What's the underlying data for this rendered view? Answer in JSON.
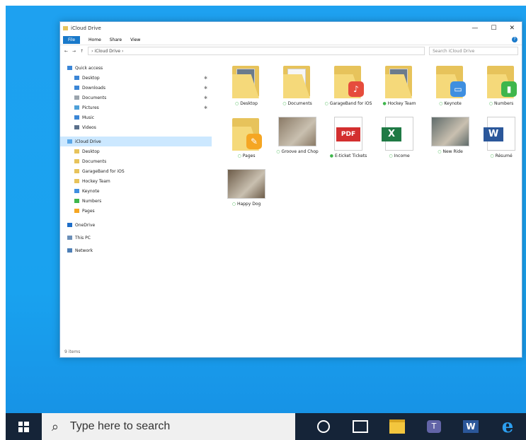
{
  "window": {
    "title": "iCloud Drive",
    "controls": {
      "minimize": "—",
      "maximize": "☐",
      "close": "✕"
    },
    "ribbon": {
      "file": "File",
      "home": "Home",
      "share": "Share",
      "view": "View",
      "help": "?"
    },
    "address": {
      "path": "› iCloud Drive ›",
      "search_placeholder": "Search iCloud Drive"
    },
    "status": "9 items"
  },
  "nav": {
    "quick_access": "Quick access",
    "quick_items": [
      {
        "label": "Desktop",
        "color": "#3b86d6",
        "pin": "✱"
      },
      {
        "label": "Downloads",
        "color": "#3b86d6",
        "pin": "✱"
      },
      {
        "label": "Documents",
        "color": "#9aa4ad",
        "pin": "✱"
      },
      {
        "label": "Pictures",
        "color": "#4ea0d8",
        "pin": "✱"
      },
      {
        "label": "Music",
        "color": "#3b86d6",
        "pin": ""
      },
      {
        "label": "Videos",
        "color": "#5a6f8a",
        "pin": ""
      }
    ],
    "icloud": "iCloud Drive",
    "icloud_items": [
      {
        "label": "Desktop",
        "color": "#e7c35b"
      },
      {
        "label": "Documents",
        "color": "#e7c35b"
      },
      {
        "label": "GarageBand for iOS",
        "color": "#e7c35b"
      },
      {
        "label": "Hockey Team",
        "color": "#e7c35b"
      },
      {
        "label": "Keynote",
        "color": "#3f8fe0"
      },
      {
        "label": "Numbers",
        "color": "#3fb64c"
      },
      {
        "label": "Pages",
        "color": "#f5a623"
      }
    ],
    "onedrive": "OneDrive",
    "this_pc": "This PC",
    "network": "Network"
  },
  "items": [
    {
      "label": "Desktop",
      "kind": "folder-photo",
      "status": "○"
    },
    {
      "label": "Documents",
      "kind": "folder-doc",
      "status": "○"
    },
    {
      "label": "GarageBand for iOS",
      "kind": "folder-badge",
      "badge_color": "#e64c3c",
      "badge_glyph": "♪",
      "status": "○"
    },
    {
      "label": "Hockey Team",
      "kind": "folder-photo",
      "status": "●"
    },
    {
      "label": "Keynote",
      "kind": "folder-badge",
      "badge_color": "#3f8fe0",
      "badge_glyph": "▭",
      "status": "○"
    },
    {
      "label": "Numbers",
      "kind": "folder-badge",
      "badge_color": "#3fb64c",
      "badge_glyph": "▮",
      "status": "○"
    },
    {
      "label": "Pages",
      "kind": "folder-badge",
      "badge_color": "#f5a623",
      "badge_glyph": "✎",
      "status": "○"
    },
    {
      "label": "Groove and Chop",
      "kind": "photo",
      "photo_color": "#8a7a66",
      "status": "○"
    },
    {
      "label": "E-ticket Tickets",
      "kind": "pdf",
      "status": "●"
    },
    {
      "label": "Income",
      "kind": "excel",
      "status": "○"
    },
    {
      "label": "New Ride",
      "kind": "photo",
      "photo_color": "#5f6b6a",
      "status": "○"
    },
    {
      "label": "Résumé",
      "kind": "word",
      "status": "○"
    },
    {
      "label": "Happy Dog",
      "kind": "photo",
      "photo_color": "#6d5c49",
      "status": "○"
    }
  ],
  "taskbar": {
    "search_placeholder": "Type here to search",
    "search_icon": "⌕",
    "edge_glyph": "e",
    "teams_glyph": "T",
    "word_glyph": "W"
  }
}
